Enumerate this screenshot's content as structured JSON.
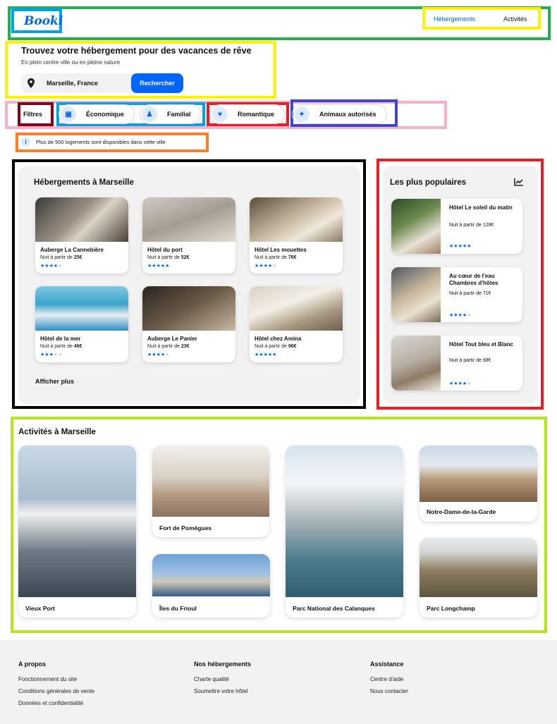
{
  "header": {
    "logo": "Booki",
    "nav": [
      "Hébergements",
      "Activités"
    ]
  },
  "hero": {
    "title": "Trouvez votre hébergement pour des vacances de rêve",
    "subtitle": "En plein centre ville ou en pleine nature",
    "search_value": "Marseille, France",
    "search_button": "Rechercher"
  },
  "filters": {
    "label": "Filtres",
    "chips": [
      "Économique",
      "Familial",
      "Romantique",
      "Animaux autorisés"
    ]
  },
  "info_text": "Plus de 500 logements sont disponibles dans cette ville",
  "accommodations": {
    "title": "Hébergements à Marseille",
    "price_prefix": "Nuit à partir de",
    "more": "Afficher plus",
    "items": [
      {
        "name": "Auberge La Cannebière",
        "price": "25€",
        "stars": 4
      },
      {
        "name": "Hôtel du port",
        "price": "52€",
        "stars": 5
      },
      {
        "name": "Hôtel Les mouettes",
        "price": "76€",
        "stars": 4
      },
      {
        "name": "Hôtel de la mer",
        "price": "46€",
        "stars": 3
      },
      {
        "name": "Auberge Le Panier",
        "price": "23€",
        "stars": 4
      },
      {
        "name": "Hôtel chez Amina",
        "price": "96€",
        "stars": 5
      }
    ]
  },
  "popular": {
    "title": "Les plus populaires",
    "items": [
      {
        "name": "Hôtel Le soleil du matin",
        "price": "128€",
        "stars": 5
      },
      {
        "name": "Au cœur de l'eau Chambres d'hôtes",
        "price": "71€",
        "stars": 4
      },
      {
        "name": "Hôtel Tout bleu et Blanc",
        "price": "68€",
        "stars": 4
      }
    ]
  },
  "activities": {
    "title": "Activités à Marseille",
    "items": [
      "Vieux Port",
      "Fort de Pomègues",
      "Îles du Frioul",
      "Parc National des Calanques",
      "Notre-Dame-de-la-Garde",
      "Parc Longchamp"
    ]
  },
  "footer": {
    "columns": [
      {
        "title": "A propos",
        "links": [
          "Fonctionnement du site",
          "Conditions générales de vente",
          "Données et confidentialité"
        ]
      },
      {
        "title": "Nos hébergements",
        "links": [
          "Charte qualité",
          "Soumettre votre hôtel"
        ]
      },
      {
        "title": "Assistance",
        "links": [
          "Centre d'aide",
          "Nous contacter"
        ]
      }
    ]
  },
  "colors": {
    "primary": "#0065fc",
    "light": "#dee9fc",
    "panel": "#f2f2f2"
  }
}
